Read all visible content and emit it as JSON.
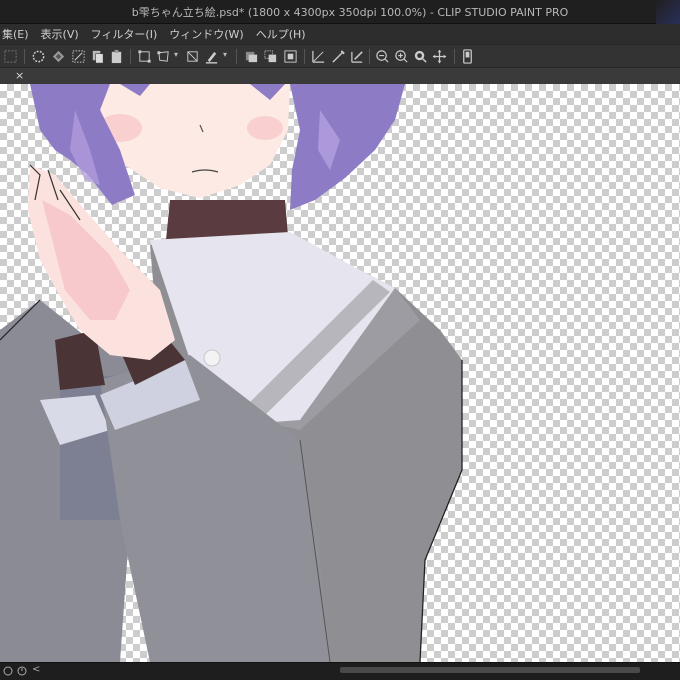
{
  "window": {
    "title": "b雫ちゃん立ち絵.psd* (1800 x 4300px 350dpi 100.0%) - CLIP STUDIO PAINT PRO"
  },
  "menu": {
    "items": [
      {
        "label": "集(E)"
      },
      {
        "label": "表示(V)"
      },
      {
        "label": "フィルター(I)"
      },
      {
        "label": "ウィンドウ(W)"
      },
      {
        "label": "ヘルプ(H)"
      }
    ]
  },
  "toolbar": {
    "icons": [
      "select-all-icon",
      "deselect-icon",
      "invert-selection-icon",
      "clear-icon",
      "copy-icon",
      "paste-icon",
      "transform-icon",
      "free-transform-icon",
      "scale-icon",
      "fill-icon",
      "layer-icon",
      "layer-merge-icon",
      "layer-snapshot-icon",
      "ruler-icon",
      "brush-ruler-icon",
      "ruler-snap-icon",
      "zoom-out-icon",
      "zoom-in-icon",
      "zoom-fit-icon",
      "move-view-icon",
      "device-icon"
    ]
  },
  "tab": {
    "close_glyph": "×"
  },
  "canvas": {
    "checker_light": "#ffffff",
    "checker_dark": "#cdcdcd",
    "hair_color": "#8e7bc6",
    "skin_color": "#fde8e3",
    "uniform_color": "#8c8c90",
    "collar_color": "#e4e2ee"
  },
  "status": {
    "nav_left": "<"
  }
}
